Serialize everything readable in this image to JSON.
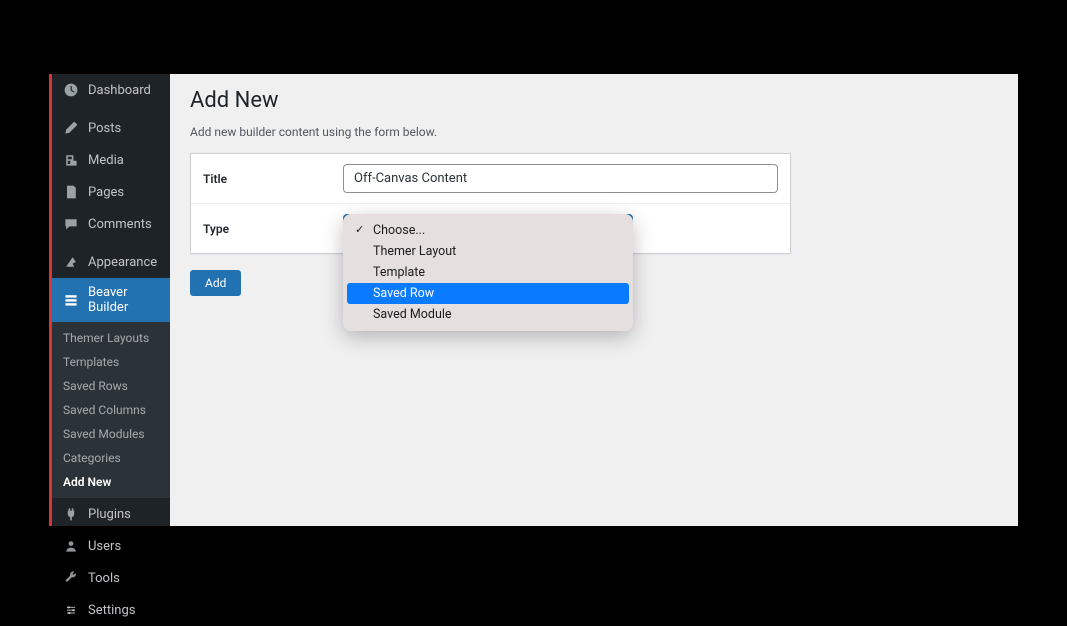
{
  "sidebar": {
    "items": [
      {
        "label": "Dashboard",
        "icon": "dashboard"
      },
      {
        "label": "Posts",
        "icon": "posts"
      },
      {
        "label": "Media",
        "icon": "media"
      },
      {
        "label": "Pages",
        "icon": "pages"
      },
      {
        "label": "Comments",
        "icon": "comments"
      },
      {
        "label": "Appearance",
        "icon": "appearance"
      },
      {
        "label": "Beaver Builder",
        "icon": "beaver"
      },
      {
        "label": "Plugins",
        "icon": "plugins"
      },
      {
        "label": "Users",
        "icon": "users"
      },
      {
        "label": "Tools",
        "icon": "tools"
      },
      {
        "label": "Settings",
        "icon": "settings"
      }
    ],
    "submenu": [
      "Themer Layouts",
      "Templates",
      "Saved Rows",
      "Saved Columns",
      "Saved Modules",
      "Categories",
      "Add New"
    ]
  },
  "main": {
    "title": "Add New",
    "description": "Add new builder content using the form below.",
    "form": {
      "title_label": "Title",
      "title_value": "Off-Canvas Content",
      "type_label": "Type",
      "type_selected": "Choose..."
    },
    "dropdown_options": [
      {
        "label": "Choose...",
        "checked": true
      },
      {
        "label": "Themer Layout"
      },
      {
        "label": "Template"
      },
      {
        "label": "Saved Row",
        "highlighted": true
      },
      {
        "label": "Saved Module"
      }
    ],
    "add_button": "Add"
  }
}
